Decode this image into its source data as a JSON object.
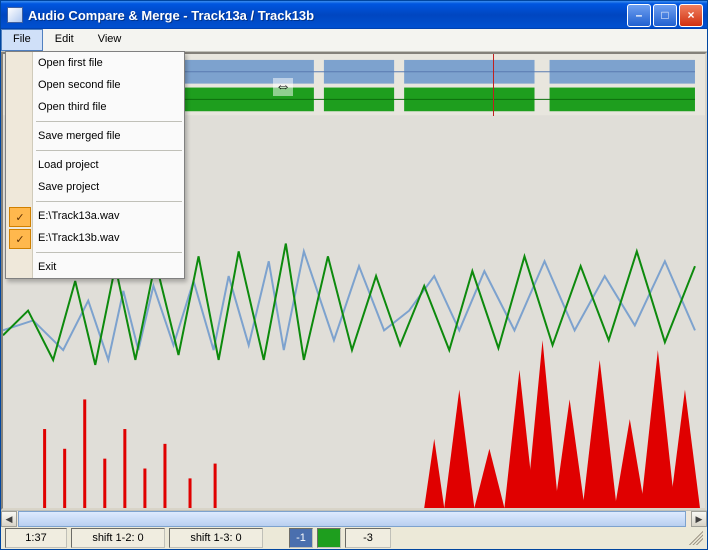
{
  "titlebar": {
    "title": "Audio Compare & Merge - Track13a / Track13b"
  },
  "menubar": {
    "file": "File",
    "edit": "Edit",
    "view": "View"
  },
  "file_menu": {
    "open_first": "Open first file",
    "open_second": "Open second file",
    "open_third": "Open third file",
    "save_merged": "Save merged file",
    "load_project": "Load project",
    "save_project": "Save project",
    "recent1": "E:\\Track13a.wav",
    "recent2": "E:\\Track13b.wav",
    "exit": "Exit"
  },
  "status": {
    "time": "1:37",
    "shift12": "shift 1-2: 0",
    "shift13": "shift 1-3: 0",
    "neg1": "-1",
    "neg3": "-3"
  },
  "colors": {
    "track1": "#7da2ce",
    "track2": "#1e9e1e",
    "diff": "#e00000",
    "swatch_blue": "#4a6fae",
    "swatch_green": "#1e9e1e"
  }
}
